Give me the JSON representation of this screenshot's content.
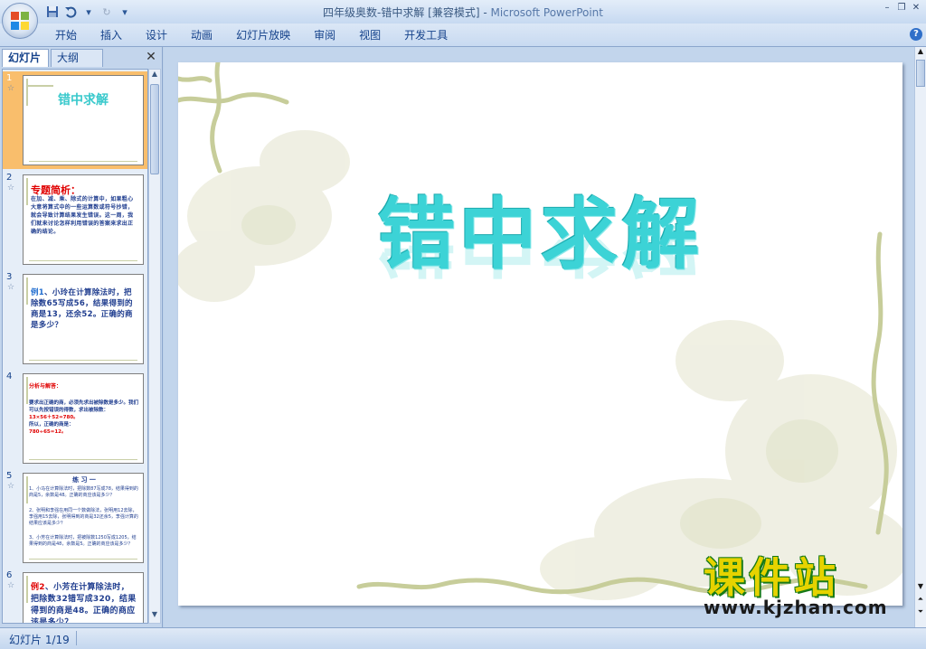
{
  "window": {
    "title": "四年级奥数-错中求解 [兼容模式] - ",
    "app_name": "Microsoft PowerPoint"
  },
  "ribbon": {
    "tabs": [
      "开始",
      "插入",
      "设计",
      "动画",
      "幻灯片放映",
      "审阅",
      "视图",
      "开发工具"
    ]
  },
  "pane": {
    "tab_slides": "幻灯片",
    "tab_outline": "大纲",
    "close": "✕"
  },
  "slides": [
    {
      "num": "1",
      "title": "错中求解"
    },
    {
      "num": "2",
      "head": "专题简析：",
      "body": "在加、减、乘、除式的计算中，如果粗心大意将算式中的一些运算数或符号抄错，就会导致计算结果发生错误。这一周，我们就来讨论怎样利用错误的答案来求出正确的结论。"
    },
    {
      "num": "3",
      "lead": "例1",
      "body": "、小玲在计算除法时，把除数65写成56，结果得到的商是13，还余52。正确的商是多少？"
    },
    {
      "num": "4",
      "head": "分析与解答：",
      "body": "要求出正确的商，必须先求出被除数是多少。我们可以先按错误的得数，求出被除数：",
      "eq1": "13×56＋52=780。",
      "mid": "所以，正确的商是：",
      "eq2": "780÷65=12。"
    },
    {
      "num": "5",
      "head": "练 习 一",
      "p1": "1、小马在计算除法时，把除数87写成78，结果得到的商是5，余数是48。正确的商应该是多少？",
      "p2": "2、张明和李强在用同一个数做除法，张明用12去除，李强用15去除，张明得到的商是32还余5，李强计算的结果应该是多少？",
      "p3": "3、小芳在计算除法时，把被除数1250写成1205，结果得到的商是48，余数是5。正确的商应该是多少？"
    },
    {
      "num": "6",
      "lead": "例2",
      "body": "、小芳在计算除法时，把除数32错写成320，结果得到的商是48。正确的商应该是多少？"
    }
  ],
  "main_slide": {
    "title": "错中求解"
  },
  "watermark": {
    "name": "课件站",
    "url": "www.kjzhan.com"
  },
  "status": {
    "slide_info": "幻灯片 1/19"
  },
  "colors": {
    "title_cyan": "#3cd3d6",
    "selection": "#f9be6c",
    "ribbon": "#c8daf1"
  }
}
